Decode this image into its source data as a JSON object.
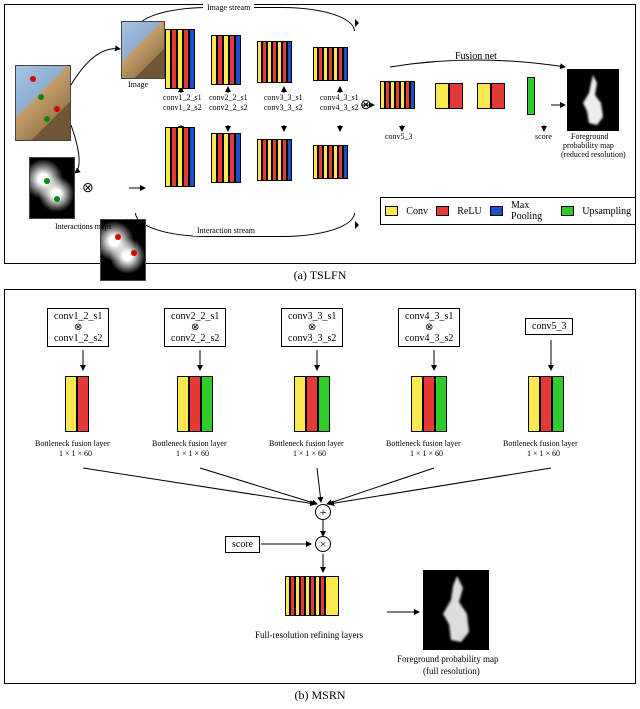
{
  "panel_a": {
    "caption": "(a) TSLFN",
    "labels": {
      "image_stream": "Image stream",
      "interaction_stream": "Interaction stream",
      "image": "Image",
      "interactions_maps": "Interactions maps",
      "fusion_net": "Fusion net",
      "score": "score",
      "fpm_reduced_l1": "Foreground",
      "fpm_reduced_l2": "probability map",
      "fpm_reduced_l3": "(reduced resolution)"
    },
    "conv_labels_top": [
      "conv1_2_s1",
      "conv2_2_s1",
      "conv3_3_s1",
      "conv4_3_s1"
    ],
    "conv_labels_bot": [
      "conv1_2_s2",
      "conv2_2_s2",
      "conv3_3_s2",
      "conv4_3_s2"
    ],
    "conv5_3": "conv5_3",
    "legend": {
      "conv": "Conv",
      "relu": "ReLU",
      "maxpool": "Max Pooling",
      "upsampling": "Upsampling"
    },
    "icon_otimes": "⊗"
  },
  "panel_b": {
    "caption": "(b) MSRN",
    "feat_boxes": [
      {
        "top": "conv1_2_s1",
        "bot": "conv1_2_s2"
      },
      {
        "top": "conv2_2_s1",
        "bot": "conv2_2_s2"
      },
      {
        "top": "conv3_3_s1",
        "bot": "conv3_3_s2"
      },
      {
        "top": "conv4_3_s1",
        "bot": "conv4_3_s2"
      }
    ],
    "feat_single": "conv5_3",
    "bfl_label": "Bottleneck fusion layer",
    "bfl_dim": "1 × 1 × 60",
    "score": "score",
    "frl_label": "Full-resolution refining layers",
    "fpm_full_l1": "Foreground probability map",
    "fpm_full_l2": "(full resolution)",
    "icon_otimes": "⊗",
    "icon_oplus": "⊕"
  },
  "chart_data": {
    "type": "diagram",
    "components": {
      "TSLFN": {
        "streams": [
          "Image stream",
          "Interaction stream"
        ],
        "image_stream_blocks": [
          {
            "name": "conv1_2_s1",
            "stage": 1,
            "ops": [
              "Conv",
              "ReLU",
              "Conv",
              "ReLU",
              "MaxPool"
            ]
          },
          {
            "name": "conv2_2_s1",
            "stage": 2,
            "ops": [
              "Conv",
              "ReLU",
              "Conv",
              "ReLU",
              "MaxPool"
            ]
          },
          {
            "name": "conv3_3_s1",
            "stage": 3,
            "ops": [
              "Conv",
              "ReLU",
              "Conv",
              "ReLU",
              "Conv",
              "ReLU",
              "MaxPool"
            ]
          },
          {
            "name": "conv4_3_s1",
            "stage": 4,
            "ops": [
              "Conv",
              "ReLU",
              "Conv",
              "ReLU",
              "Conv",
              "ReLU",
              "MaxPool"
            ]
          }
        ],
        "interaction_stream_blocks": [
          {
            "name": "conv1_2_s2",
            "stage": 1,
            "ops": [
              "Conv",
              "ReLU",
              "Conv",
              "ReLU",
              "MaxPool"
            ]
          },
          {
            "name": "conv2_2_s2",
            "stage": 2,
            "ops": [
              "Conv",
              "ReLU",
              "Conv",
              "ReLU",
              "MaxPool"
            ]
          },
          {
            "name": "conv3_3_s2",
            "stage": 3,
            "ops": [
              "Conv",
              "ReLU",
              "Conv",
              "ReLU",
              "Conv",
              "ReLU",
              "MaxPool"
            ]
          },
          {
            "name": "conv4_3_s2",
            "stage": 4,
            "ops": [
              "Conv",
              "ReLU",
              "Conv",
              "ReLU",
              "Conv",
              "ReLU",
              "MaxPool"
            ]
          }
        ],
        "stream_merge": "concat (⊗)",
        "fusion_net": {
          "blocks": [
            {
              "name": "conv5_3",
              "ops": [
                "Conv",
                "ReLU",
                "Conv",
                "ReLU",
                "Conv",
                "ReLU",
                "MaxPool"
              ]
            },
            {
              "ops": [
                "Conv",
                "ReLU"
              ]
            },
            {
              "ops": [
                "Conv",
                "ReLU"
              ]
            },
            {
              "name": "score",
              "ops": [
                "Upsampling"
              ]
            }
          ],
          "output": "Foreground probability map (reduced resolution)"
        },
        "legend": {
          "Conv": "yellow",
          "ReLU": "red",
          "Max Pooling": "blue",
          "Upsampling": "green"
        }
      },
      "MSRN": {
        "inputs": [
          "conv1_2_s1 ⊗ conv1_2_s2",
          "conv2_2_s1 ⊗ conv2_2_s2",
          "conv3_3_s1 ⊗ conv3_3_s2",
          "conv4_3_s1 ⊗ conv4_3_s2",
          "conv5_3"
        ],
        "per_input_block": {
          "name": "Bottleneck fusion layer",
          "kernel": "1×1×60",
          "ops_by_input": [
            [
              "Conv",
              "ReLU"
            ],
            [
              "Conv",
              "ReLU",
              "Upsampling"
            ],
            [
              "Conv",
              "ReLU",
              "Upsampling"
            ],
            [
              "Conv",
              "ReLU",
              "Upsampling"
            ],
            [
              "Conv",
              "ReLU",
              "Upsampling"
            ]
          ]
        },
        "sum": "⊕ elementwise sum of bottleneck outputs",
        "concat_with": "score (⊗)",
        "refiner": {
          "name": "Full-resolution refining layers",
          "ops": [
            "Conv",
            "ReLU",
            "Conv",
            "ReLU",
            "Conv",
            "ReLU",
            "Conv",
            "ReLU",
            "Conv"
          ]
        },
        "output": "Foreground probability map (full resolution)"
      }
    }
  }
}
